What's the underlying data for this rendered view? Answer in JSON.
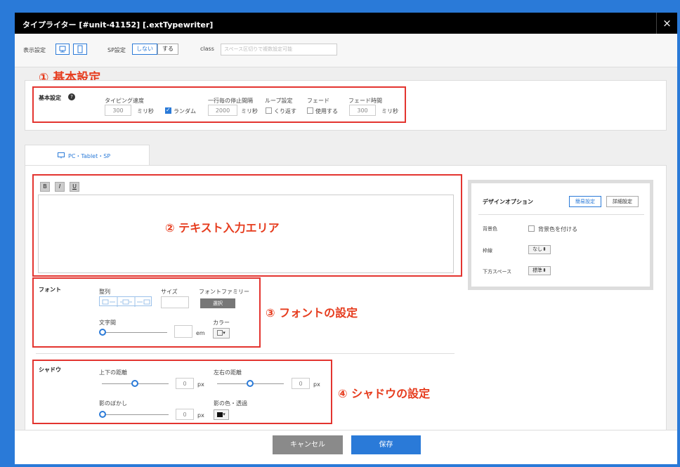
{
  "window": {
    "title": "タイプライター [#unit-41152] [.extTypewriter]",
    "close": "×"
  },
  "display_bar": {
    "display_label": "表示設定",
    "sp_label": "SP設定",
    "sp_off": "しない",
    "sp_on": "する",
    "class_label": "class",
    "class_placeholder": "スペース区切りで複数設定可能"
  },
  "annotations": {
    "a1": "① 基本設定",
    "a2": "② テキスト入力エリア",
    "a3": "③ フォントの設定",
    "a4": "④ シャドウの設定"
  },
  "basic": {
    "heading": "基本設定",
    "help": "?",
    "typing_speed_label": "タイピング速度",
    "typing_speed_value": "300",
    "ms1": "ミリ秒",
    "random_label": "ランダム",
    "random_checked": true,
    "line_pause_label": "一行毎の停止間隔",
    "line_pause_value": "2000",
    "ms2": "ミリ秒",
    "loop_label": "ループ設定",
    "loop_option": "くり返す",
    "fade_label": "フェード",
    "fade_option": "使用する",
    "fade_time_label": "フェード時間",
    "fade_time_value": "300",
    "ms3": "ミリ秒"
  },
  "tab": {
    "label": "PC・Tablet・SP"
  },
  "editor": {
    "bold": "B",
    "italic": "I",
    "underline": "U"
  },
  "font": {
    "heading": "フォント",
    "align_label": "整列",
    "size_label": "サイズ",
    "family_label": "フォントファミリー",
    "select_button": "選択",
    "spacing_label": "文字間",
    "em": "em",
    "color_label": "カラー",
    "color_arrow": "▾"
  },
  "shadow": {
    "heading": "シャドウ",
    "vertical_label": "上下の距離",
    "vertical_value": "0",
    "px1": "px",
    "horizontal_label": "左右の距離",
    "horizontal_value": "0",
    "px2": "px",
    "blur_label": "影のぼかし",
    "blur_value": "0",
    "px3": "px",
    "color_label": "影の色・透過",
    "color_arrow": "▾"
  },
  "design": {
    "heading": "デザインオプション",
    "simple": "簡易設定",
    "detail": "詳細設定",
    "bg_label": "背景色",
    "bg_option": "背景色を付ける",
    "border_label": "枠線",
    "border_value": "なし",
    "space_label": "下方スペース",
    "space_value": "標準",
    "arrow": "⬍"
  },
  "footer": {
    "cancel": "キャンセル",
    "save": "保存"
  },
  "colors": {
    "accent": "#2a7ad8",
    "annotation": "#e63c1e",
    "titlebar": "#000000"
  }
}
